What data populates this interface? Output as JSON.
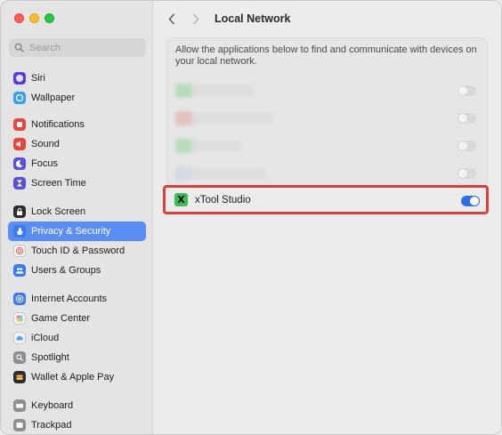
{
  "sidebar": {
    "search_placeholder": "Search",
    "groups": [
      [
        {
          "label": "Siri",
          "icon": "siri-icon",
          "color": "#5b3bd6"
        },
        {
          "label": "Wallpaper",
          "icon": "wallpaper-icon",
          "color": "#3aa0e8"
        }
      ],
      [
        {
          "label": "Notifications",
          "icon": "notifications-icon",
          "color": "#e8453c"
        },
        {
          "label": "Sound",
          "icon": "sound-icon",
          "color": "#e8453c"
        },
        {
          "label": "Focus",
          "icon": "focus-icon",
          "color": "#5a4fd6"
        },
        {
          "label": "Screen Time",
          "icon": "screen-time-icon",
          "color": "#5a4fd6"
        }
      ],
      [
        {
          "label": "Lock Screen",
          "icon": "lock-icon",
          "color": "#2c2c2e"
        },
        {
          "label": "Privacy & Security",
          "icon": "hand-icon",
          "color": "#3a7bf0",
          "active": true
        },
        {
          "label": "Touch ID & Password",
          "icon": "fingerprint-icon",
          "color": "#f2f2f2"
        },
        {
          "label": "Users & Groups",
          "icon": "users-icon",
          "color": "#3a7bf0"
        }
      ],
      [
        {
          "label": "Internet Accounts",
          "icon": "at-icon",
          "color": "#3a7bf0"
        },
        {
          "label": "Game Center",
          "icon": "game-center-icon",
          "color": "#f2f2f2"
        },
        {
          "label": "iCloud",
          "icon": "icloud-icon",
          "color": "#f2f2f2"
        },
        {
          "label": "Spotlight",
          "icon": "spotlight-icon",
          "color": "#8e8e93"
        },
        {
          "label": "Wallet & Apple Pay",
          "icon": "wallet-icon",
          "color": "#2c2c2e"
        }
      ],
      [
        {
          "label": "Keyboard",
          "icon": "keyboard-icon",
          "color": "#8e8e93"
        },
        {
          "label": "Trackpad",
          "icon": "trackpad-icon",
          "color": "#8e8e93"
        }
      ]
    ]
  },
  "main": {
    "title": "Local Network",
    "description": "Allow the applications below to find and communicate with devices on your local network.",
    "rows": [
      {
        "on": false,
        "icon_color": "#5cc46a"
      },
      {
        "on": false,
        "icon_color": "#e07a6a"
      },
      {
        "on": false,
        "icon_color": "#5cc46a"
      },
      {
        "on": false,
        "icon_color": "#b0c4e0"
      }
    ],
    "highlighted_app": {
      "name": "xTool Studio",
      "icon_glyph": "X",
      "on": true
    }
  }
}
